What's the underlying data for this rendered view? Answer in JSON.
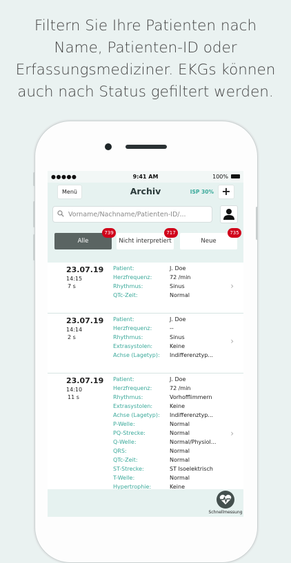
{
  "caption": [
    "Filtern Sie Ihre Patienten nach",
    "Name, Patienten-ID oder",
    "Erfassungsmediziner. EKGs können",
    "auch nach Status gefiltert werden."
  ],
  "statusbar": {
    "carrier": "●●●●● ",
    "time": "9:41 AM",
    "battery": "100%"
  },
  "nav": {
    "menu": "Menü",
    "title": "Archiv",
    "isp": "ISP 30%"
  },
  "search": {
    "placeholder": "Vorname/Nachname/Patienten-ID/..."
  },
  "filters": [
    {
      "label": "Alle",
      "count": "739"
    },
    {
      "label": "Nicht interpretiert",
      "count": "717"
    },
    {
      "label": "Neue",
      "count": "735"
    }
  ],
  "entries": [
    {
      "date": "23.07.19",
      "time": "14:15",
      "duration": "7 s",
      "rows": [
        {
          "label": "Patient:",
          "value": "J. Doe"
        },
        {
          "label": "Herzfrequenz:",
          "value": "72 /min"
        },
        {
          "label": "Rhythmus:",
          "value": "Sinus"
        },
        {
          "label": "QTc-Zeit:",
          "value": "Normal"
        }
      ]
    },
    {
      "date": "23.07.19",
      "time": "14:14",
      "duration": "2 s",
      "rows": [
        {
          "label": "Patient:",
          "value": "J. Doe"
        },
        {
          "label": "Herzfrequenz:",
          "value": "--"
        },
        {
          "label": "Rhythmus:",
          "value": "Sinus"
        },
        {
          "label": "Extrasystolen:",
          "value": "Keine"
        },
        {
          "label": "Achse (Lagetyp):",
          "value": "Indifferenztyp..."
        }
      ]
    },
    {
      "date": "23.07.19",
      "time": "14:10",
      "duration": "11 s",
      "rows": [
        {
          "label": "Patient:",
          "value": "J. Doe"
        },
        {
          "label": "Herzfrequenz:",
          "value": "72 /min"
        },
        {
          "label": "Rhythmus:",
          "value": "Vorhofflimmern"
        },
        {
          "label": "Extrasystolen:",
          "value": "Keine"
        },
        {
          "label": "Achse (Lagetyp):",
          "value": "Indifferenztyp..."
        },
        {
          "label": "P-Welle:",
          "value": "Normal"
        },
        {
          "label": "PQ-Strecke:",
          "value": "Normal"
        },
        {
          "label": "Q-Welle:",
          "value": "Normal/Physiol..."
        },
        {
          "label": "QRS:",
          "value": "Normal"
        },
        {
          "label": "QTc-Zeit:",
          "value": "Normal"
        },
        {
          "label": "ST-Strecke:",
          "value": "ST Isoelektrisch"
        },
        {
          "label": "T-Welle:",
          "value": "Normal"
        },
        {
          "label": "Hypertrophie:",
          "value": "Keine"
        }
      ]
    }
  ],
  "quick": {
    "label": "Schnellmessung",
    "icon": "heart-pulse-icon"
  },
  "colors": {
    "accent": "#3aa99a",
    "badge": "#d0021b",
    "header_bg": "#e6f2f0",
    "active_filter": "#5a6462"
  }
}
